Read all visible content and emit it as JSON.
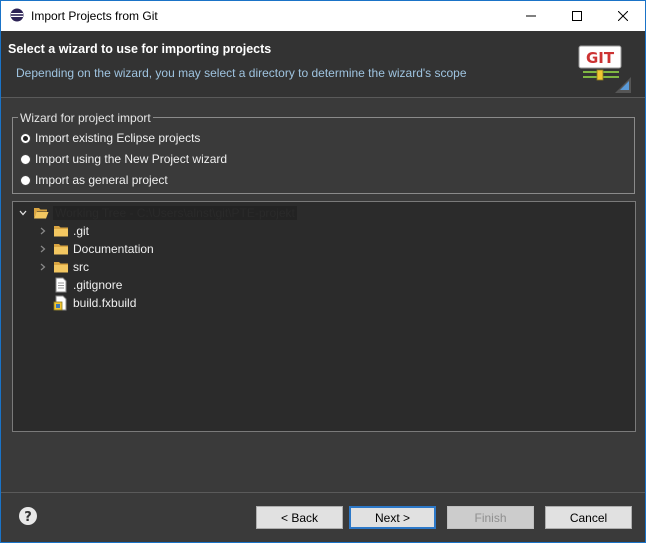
{
  "window": {
    "title": "Import Projects from Git"
  },
  "header": {
    "title": "Select a wizard to use for importing projects",
    "subtitle": "Depending on the wizard, you may select a directory to determine the wizard's scope",
    "logo_text": "GIT"
  },
  "wizard_group": {
    "legend": "Wizard for project import",
    "options": [
      {
        "label": "Import existing Eclipse projects",
        "selected": true
      },
      {
        "label": "Import using the New Project wizard",
        "selected": false
      },
      {
        "label": "Import as general project",
        "selected": false
      }
    ]
  },
  "tree": {
    "root": {
      "label": "Working Tree - C:\\Users\\alnst\\git\\PTE-projekt",
      "icon": "folder-open-icon",
      "expanded": true
    },
    "children": [
      {
        "label": ".git",
        "icon": "folder-icon",
        "expandable": true
      },
      {
        "label": "Documentation",
        "icon": "folder-icon",
        "expandable": true
      },
      {
        "label": "src",
        "icon": "folder-icon",
        "expandable": true
      },
      {
        "label": ".gitignore",
        "icon": "file-icon",
        "expandable": false
      },
      {
        "label": "build.fxbuild",
        "icon": "fxbuild-file-icon",
        "expandable": false
      }
    ]
  },
  "buttons": {
    "back": "< Back",
    "next": "Next >",
    "finish": "Finish",
    "cancel": "Cancel"
  },
  "colors": {
    "accent": "#2c78c8",
    "background": "#3a3a3a",
    "subtitle": "#9fc4e0"
  }
}
